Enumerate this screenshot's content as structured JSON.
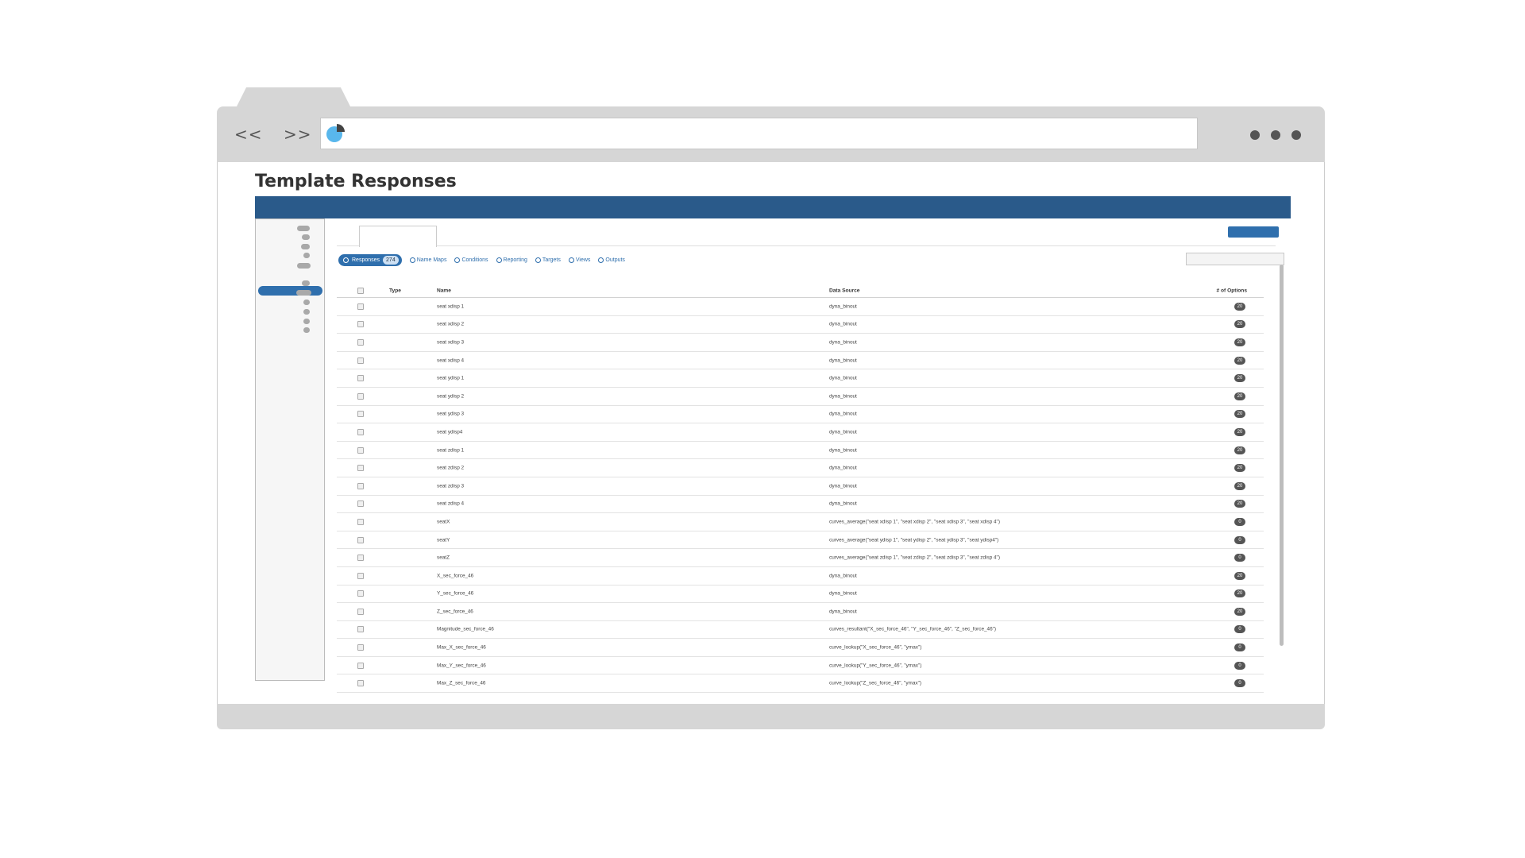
{
  "browser": {
    "back_label": "<<",
    "forward_label": ">>",
    "favicon_icon": "pie-chart-icon",
    "menu_icon": "three-dots-icon"
  },
  "page": {
    "title": "Template Responses"
  },
  "filters": {
    "responses_label": "Responses",
    "responses_count": "274",
    "links": [
      "Name Maps",
      "Conditions",
      "Reporting",
      "Targets",
      "Views",
      "Outputs"
    ]
  },
  "table": {
    "headers": {
      "type": "Type",
      "name": "Name",
      "data_source": "Data Source",
      "options": "# of Options"
    },
    "rows": [
      {
        "name": "seat xdisp 1",
        "source": "dyna_binout",
        "options": "20"
      },
      {
        "name": "seat xdisp 2",
        "source": "dyna_binout",
        "options": "20"
      },
      {
        "name": "seat xdisp 3",
        "source": "dyna_binout",
        "options": "20"
      },
      {
        "name": "seat xdisp 4",
        "source": "dyna_binout",
        "options": "20"
      },
      {
        "name": "seat ydisp 1",
        "source": "dyna_binout",
        "options": "20"
      },
      {
        "name": "seat ydisp 2",
        "source": "dyna_binout",
        "options": "20"
      },
      {
        "name": "seat ydisp 3",
        "source": "dyna_binout",
        "options": "20"
      },
      {
        "name": "seat ydisp4",
        "source": "dyna_binout",
        "options": "20"
      },
      {
        "name": "seat zdisp 1",
        "source": "dyna_binout",
        "options": "20"
      },
      {
        "name": "seat zdisp 2",
        "source": "dyna_binout",
        "options": "20"
      },
      {
        "name": "seat zdisp 3",
        "source": "dyna_binout",
        "options": "20"
      },
      {
        "name": "seat zdisp 4",
        "source": "dyna_binout",
        "options": "20"
      },
      {
        "name": "seatX",
        "source": "curves_average(\"seat xdisp 1\", \"seat xdisp 2\", \"seat xdisp 3\", \"seat xdisp 4\")",
        "options": "0"
      },
      {
        "name": "seatY",
        "source": "curves_average(\"seat ydisp 1\", \"seat ydisp 2\", \"seat ydisp 3\", \"seat ydisp4\")",
        "options": "0"
      },
      {
        "name": "seatZ",
        "source": "curves_average(\"seat zdisp 1\", \"seat zdisp 2\", \"seat zdisp 3\", \"seat zdisp 4\")",
        "options": "0"
      },
      {
        "name": "X_sec_force_46",
        "source": "dyna_binout",
        "options": "20"
      },
      {
        "name": "Y_sec_force_46",
        "source": "dyna_binout",
        "options": "20"
      },
      {
        "name": "Z_sec_force_46",
        "source": "dyna_binout",
        "options": "20"
      },
      {
        "name": "Magnitude_sec_force_46",
        "source": "curves_resultant(\"X_sec_force_46\", \"Y_sec_force_46\", \"Z_sec_force_46\")",
        "options": "0"
      },
      {
        "name": "Max_X_sec_force_46",
        "source": "curve_lookup(\"X_sec_force_46\", \"ymax\")",
        "options": "0"
      },
      {
        "name": "Max_Y_sec_force_46",
        "source": "curve_lookup(\"Y_sec_force_46\", \"ymax\")",
        "options": "0"
      },
      {
        "name": "Max_Z_sec_force_46",
        "source": "curve_lookup(\"Z_sec_force_46\", \"ymax\")",
        "options": "0"
      }
    ]
  },
  "colors": {
    "brand": "#2a5a8a",
    "accent": "#2f6fad",
    "chrome": "#d6d6d6",
    "badge": "#555555"
  }
}
